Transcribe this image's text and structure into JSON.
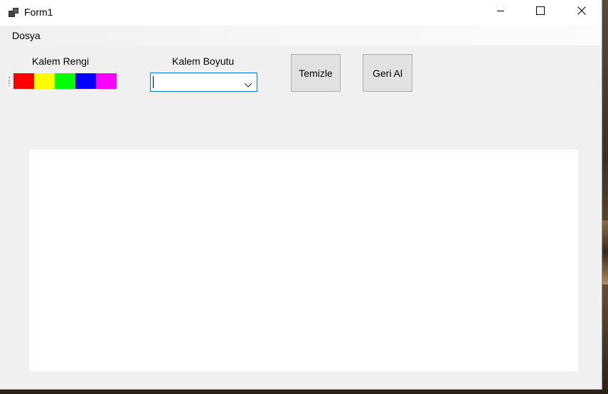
{
  "window": {
    "title": "Form1",
    "icon": "winforms-app-icon",
    "controls": {
      "minimize_icon": "minimize-icon",
      "maximize_icon": "maximize-icon",
      "close_icon": "close-icon"
    }
  },
  "menu": {
    "items": [
      {
        "label": "Dosya"
      }
    ]
  },
  "pen_color": {
    "label": "Kalem Rengi",
    "swatches": [
      {
        "name": "red",
        "color": "#ff0000"
      },
      {
        "name": "yellow",
        "color": "#ffff00"
      },
      {
        "name": "green",
        "color": "#00ff00"
      },
      {
        "name": "blue",
        "color": "#0000ff"
      },
      {
        "name": "magenta",
        "color": "#ff00ff"
      }
    ]
  },
  "pen_size": {
    "label": "Kalem Boyutu",
    "value": ""
  },
  "buttons": {
    "clear_label": "Temizle",
    "undo_label": "Geri Al"
  },
  "colors": {
    "window_bg": "#f0f0f0",
    "canvas_bg": "#ffffff",
    "combo_border": "#0078d7",
    "button_bg": "#e1e1e1"
  }
}
